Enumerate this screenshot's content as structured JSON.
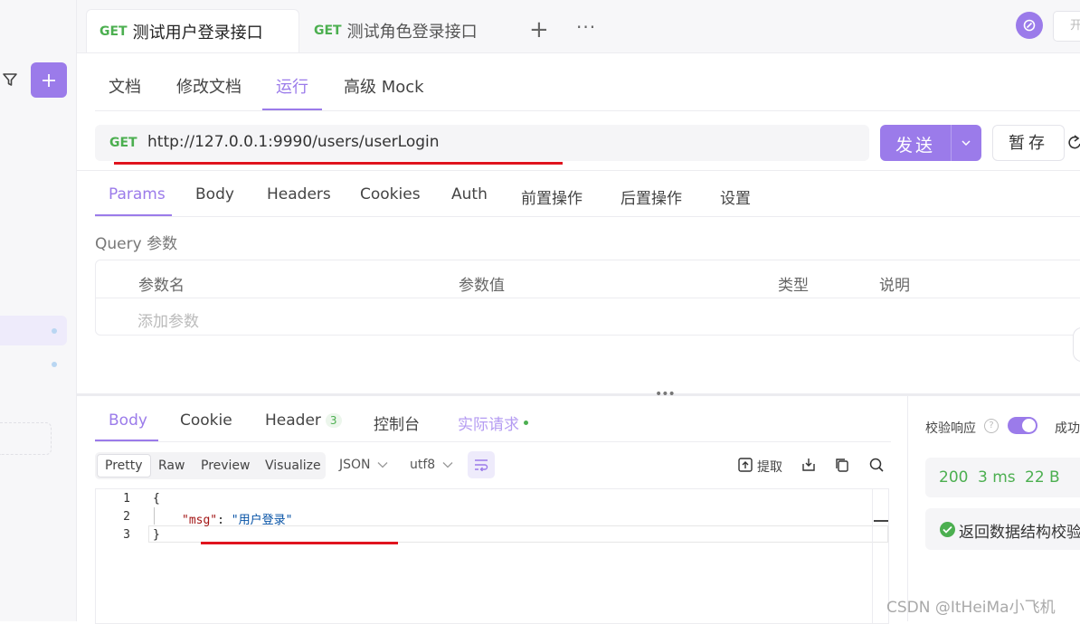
{
  "tabs": [
    {
      "method": "GET",
      "label": "测试用户登录接口"
    },
    {
      "method": "GET",
      "label": "测试角色登录接口"
    }
  ],
  "tab_controls": {
    "add": "+",
    "more": "···"
  },
  "header": {
    "open_label": "开"
  },
  "main_tabs": {
    "doc": "文档",
    "edit_doc": "修改文档",
    "run": "运行",
    "mock": "高级 Mock"
  },
  "request": {
    "method": "GET",
    "url": "http://127.0.0.1:9990/users/userLogin",
    "send_label": "发送",
    "save_label": "暂存"
  },
  "request_tabs": [
    "Params",
    "Body",
    "Headers",
    "Cookies",
    "Auth",
    "前置操作",
    "后置操作",
    "设置"
  ],
  "query": {
    "title": "Query 参数",
    "columns": [
      "参数名",
      "参数值",
      "类型",
      "说明"
    ],
    "add_placeholder": "添加参数"
  },
  "response_tabs": {
    "body": "Body",
    "cookie": "Cookie",
    "header": "Header",
    "header_count": "3",
    "console": "控制台",
    "actual_request": "实际请求"
  },
  "view_modes": [
    "Pretty",
    "Raw",
    "Preview",
    "Visualize"
  ],
  "format": {
    "type": "JSON",
    "encoding": "utf8"
  },
  "toolbar": {
    "extract": "提取"
  },
  "editor": {
    "line_numbers": [
      "1",
      "2",
      "3"
    ],
    "line1": "{",
    "key": "\"msg\"",
    "colon": ": ",
    "value": "\"用户登录\"",
    "line3": "}"
  },
  "validation": {
    "label": "校验响应",
    "help": "?",
    "success": "成功",
    "status": "200",
    "time": "3 ms",
    "size": "22 B",
    "result": "返回数据结构校验"
  },
  "watermark": "CSDN @ItHeiMa小飞机",
  "colors": {
    "accent": "#9b7bea",
    "get": "#4caf50",
    "annotation": "#e0141e"
  }
}
